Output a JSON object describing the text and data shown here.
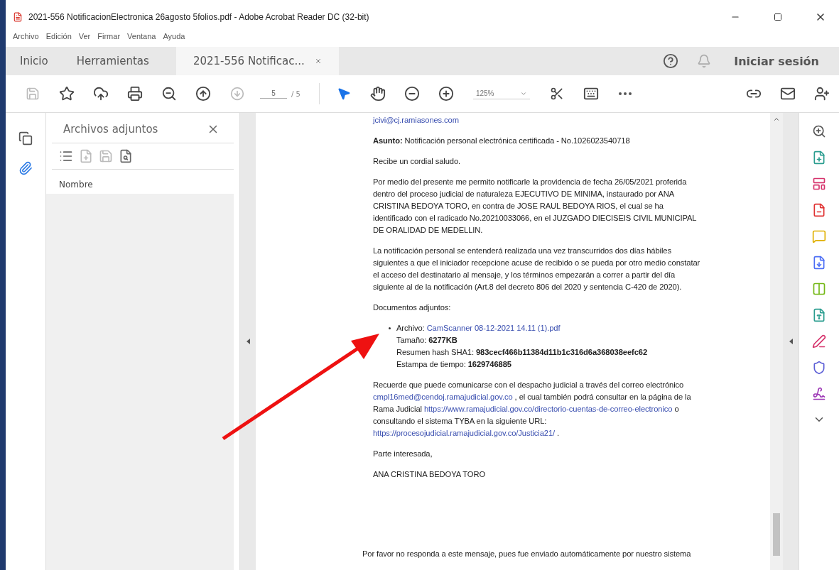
{
  "window": {
    "title": "2021-556 NotificacionElectronica 26agosto 5folios.pdf - Adobe Acrobat Reader DC (32-bit)"
  },
  "menu": [
    "Archivo",
    "Edición",
    "Ver",
    "Firmar",
    "Ventana",
    "Ayuda"
  ],
  "tabs": [
    {
      "label": "Inicio",
      "selected": false
    },
    {
      "label": "Herramientas",
      "selected": false
    },
    {
      "label": "2021-556 Notificac...",
      "selected": true
    }
  ],
  "sign_in": "Iniciar sesión",
  "toolbar": {
    "page_current": "5",
    "page_total": "/ 5",
    "zoom": "125%"
  },
  "attachments_panel": {
    "title": "Archivos adjuntos",
    "column": "Nombre"
  },
  "document": [
    {
      "kind": "link_line",
      "text": "jcivi@cj.ramiasones.com"
    },
    {
      "kind": "paragraph",
      "parts": [
        {
          "text": "**Asunto:** Notificación personal electrónica certificada - No.1026023540718",
          "link": false
        }
      ]
    },
    {
      "kind": "paragraph",
      "parts": [
        {
          "text": "Recibe un cordial saludo.",
          "link": false
        }
      ]
    },
    {
      "kind": "paragraph",
      "parts": [
        {
          "text": "Por medio del presente me permito notificarle la providencia de fecha 26/05/2021 proferida dentro del proceso judicial de naturaleza EJECUTIVO DE MINIMA, instaurado por ANA CRISTINA BEDOYA TORO, en contra de JOSE RAUL BEDOYA RIOS, el cual se ha identificado con el radicado No.20210033066, en el JUZGADO DIECISEIS CIVIL MUNICIPAL DE ORALIDAD DE MEDELLIN.",
          "link": false
        }
      ]
    },
    {
      "kind": "paragraph",
      "parts": [
        {
          "text": "La notificación personal se entenderá realizada una vez transcurridos dos días hábiles siguientes a que el iniciador recepcione acuse de recibido o se pueda por otro medio constatar el acceso del destinatario al mensaje, y los términos empezarán a correr a partir del día siguiente al de la notificación (Art.8 del decreto 806 del 2020 y sentencia C-420 de 2020).",
          "link": false
        }
      ]
    },
    {
      "kind": "paragraph",
      "parts": [
        {
          "text": "Documentos adjuntos:",
          "link": false
        }
      ]
    },
    {
      "kind": "attachment",
      "lines": [
        [
          {
            "text": "Archivo:",
            "link": false
          },
          {
            "text": "CamScanner 08-12-2021 14.11 (1).pdf",
            "link": true
          }
        ],
        [
          {
            "text": "Tamaño: **6277KB**",
            "link": false
          }
        ],
        [
          {
            "text": "Resumen hash SHA1: **983cecf466b11384d11b1c316d6a368038eefc62**",
            "link": false
          }
        ],
        [
          {
            "text": "Estampa de tiempo: **1629746885**",
            "link": false
          }
        ]
      ]
    },
    {
      "kind": "paragraph",
      "parts": [
        {
          "text": "Recuerde que puede comunicarse con el despacho judicial a través del correo electrónico",
          "link": false
        },
        {
          "text": "cmpl16med@cendoj.ramajudicial.gov.co",
          "link": true
        },
        {
          "text": ", el cual también podrá consultar en la página de la Rama Judicial",
          "link": false
        },
        {
          "text": "https://www.ramajudicial.gov.co/directorio-cuentas-de-correo-electronico",
          "link": true
        },
        {
          "text": "o consultando el sistema TYBA en la siguiente URL:",
          "link": false
        },
        {
          "text": "https://procesojudicial.ramajudicial.gov.co/Justicia21/",
          "link": true
        },
        {
          "text": ".",
          "link": false
        }
      ]
    },
    {
      "kind": "paragraph",
      "parts": [
        {
          "text": "Parte interesada,",
          "link": false
        }
      ]
    },
    {
      "kind": "paragraph",
      "parts": [
        {
          "text": "ANA CRISTINA BEDOYA TORO",
          "link": false
        }
      ]
    },
    {
      "kind": "footer",
      "parts": [
        {
          "text": "Por favor no responda a este mensaje, pues fue enviado automáticamente por nuestro sistema",
          "link": false
        }
      ]
    }
  ]
}
